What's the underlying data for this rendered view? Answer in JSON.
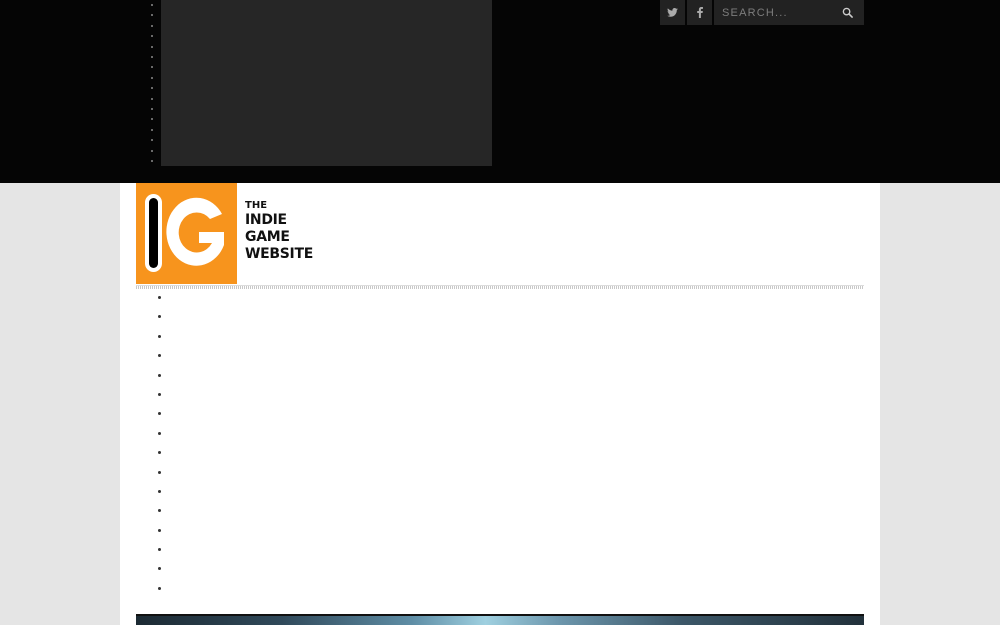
{
  "header": {
    "social": [
      {
        "name": "twitter-icon"
      },
      {
        "name": "facebook-icon"
      }
    ],
    "search": {
      "placeholder": "SEARCH...",
      "value": "",
      "icon": "search-icon"
    }
  },
  "logo": {
    "letters": "IG",
    "line1": "THE",
    "line2": "INDIE",
    "line3": "GAME",
    "line4": "WEBSITE",
    "accent_color": "#f7941d"
  },
  "menu": {
    "item_count": 16
  },
  "colors": {
    "top_bar": "#050505",
    "page_bg": "#e5e5e5",
    "content_bg": "#ffffff"
  }
}
